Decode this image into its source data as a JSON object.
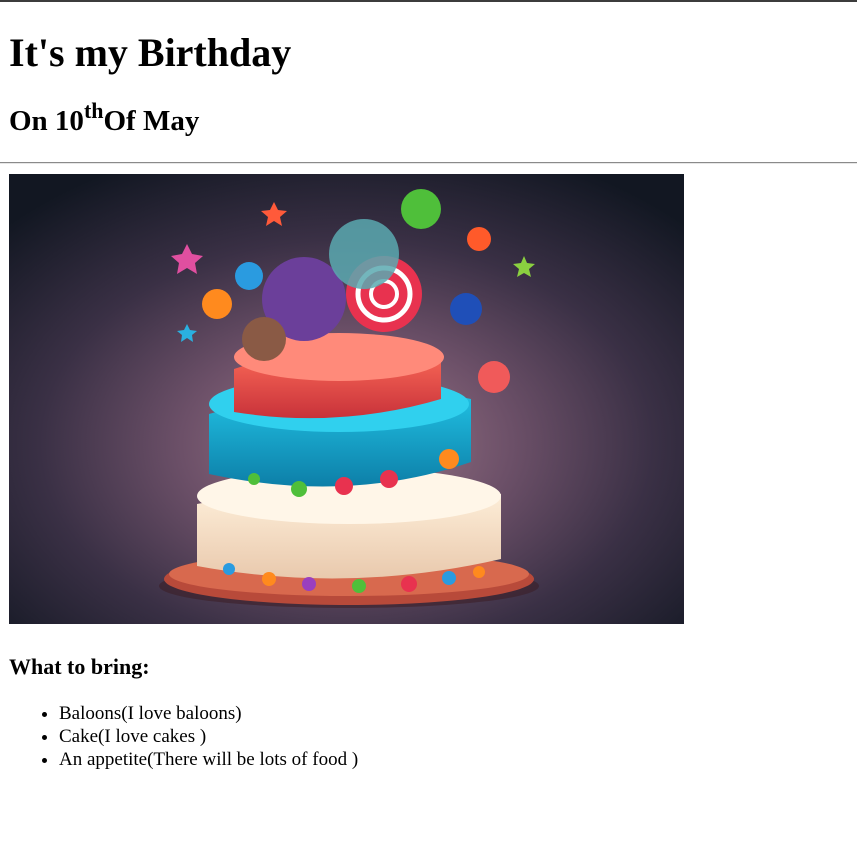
{
  "heading": "It's my Birthday",
  "date": {
    "prefix": "On 10",
    "superscript": "th",
    "suffix": "Of May"
  },
  "image": {
    "alt": "Colorful birthday cake"
  },
  "bring_heading": "What to bring:",
  "bring_items": [
    "Baloons(I love baloons)",
    "Cake(I love cakes )",
    "An appetite(There will be lots of food )"
  ],
  "colors": {
    "text": "#000000",
    "background": "#ffffff",
    "rule": "#8a8a8a"
  }
}
